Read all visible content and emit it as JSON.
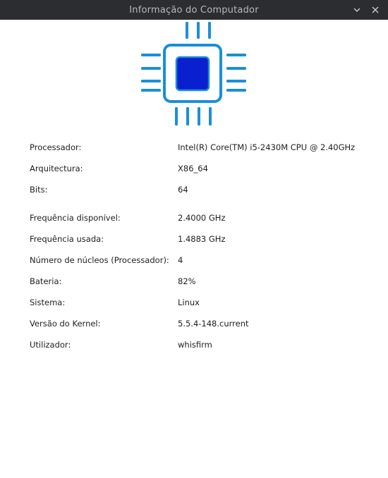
{
  "window": {
    "title": "Informação do Computador"
  },
  "colors": {
    "titlebar_bg": "#2b2d31",
    "chip_outline": "#1a8fd6",
    "chip_core": "#0a1fd0"
  },
  "icons": {
    "header": "cpu-chip-icon",
    "minimize": "minimize-icon",
    "close": "close-icon"
  },
  "info": {
    "rows": [
      {
        "label": "Processador:",
        "value": "Intel(R) Core(TM) i5-2430M CPU @ 2.40GHz"
      },
      {
        "label": "Arquitectura:",
        "value": "X86_64"
      },
      {
        "label": "Bits:",
        "value": "64"
      },
      {
        "label": "Frequência disponível:",
        "value": "2.4000 GHz"
      },
      {
        "label": "Frequência usada:",
        "value": "1.4883 GHz"
      },
      {
        "label": "Número de núcleos (Processador):",
        "value": "4"
      },
      {
        "label": "Bateria:",
        "value": "82%"
      },
      {
        "label": "Sistema:",
        "value": "Linux"
      },
      {
        "label": "Versão do Kernel:",
        "value": "5.5.4-148.current"
      },
      {
        "label": "Utilizador:",
        "value": "whisfirm"
      }
    ]
  }
}
